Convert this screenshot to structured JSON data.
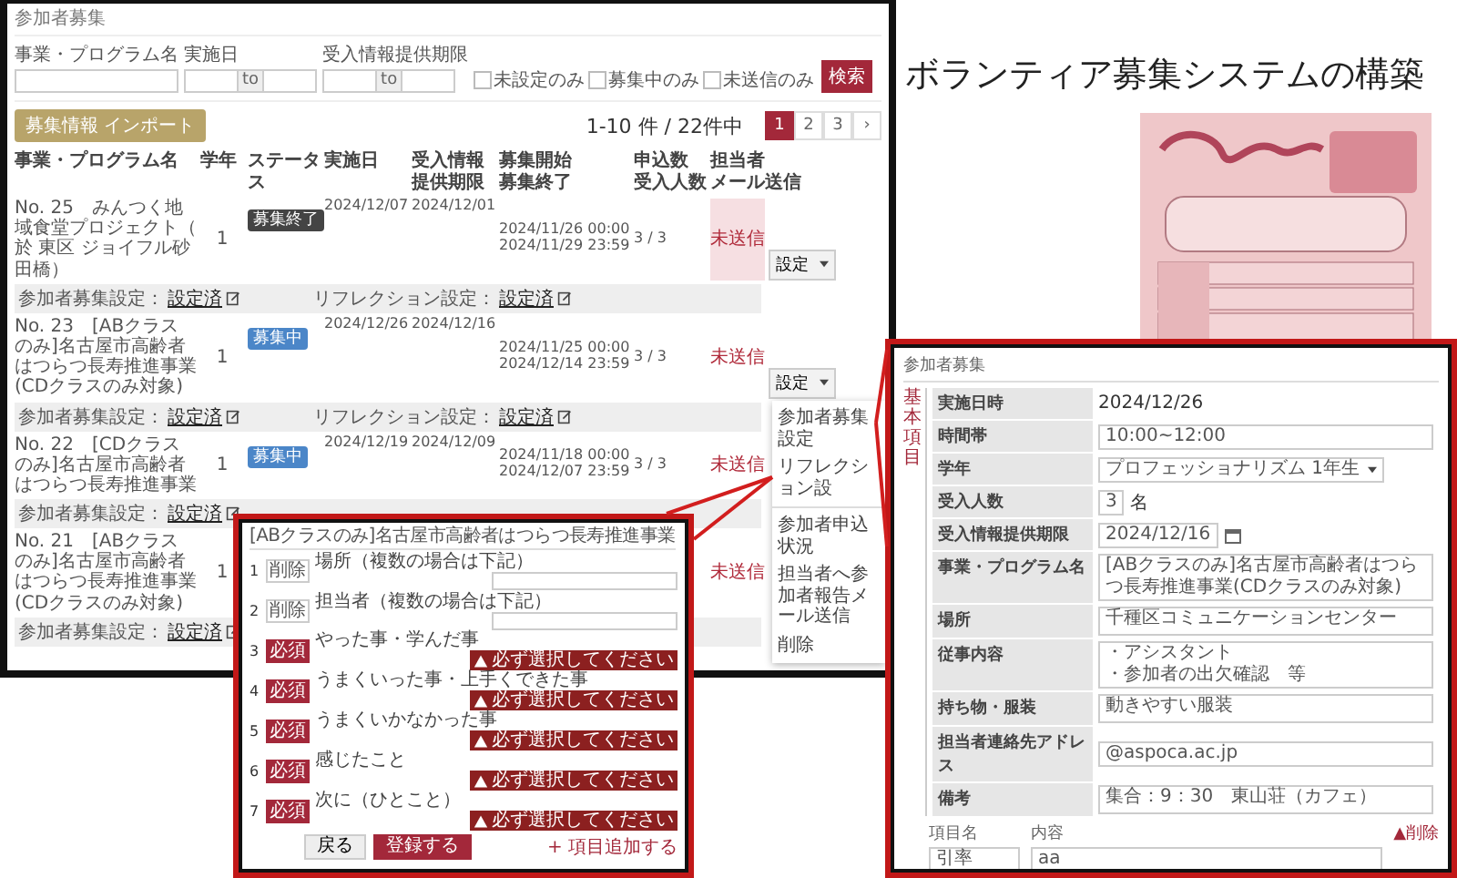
{
  "slide_title": "ボランティア募集システムの構築",
  "main": {
    "title": "参加者募集",
    "filters": [
      {
        "label": "事業・プログラム名",
        "kind": "text"
      },
      {
        "label": "実施日",
        "kind": "range",
        "separator": "to"
      },
      {
        "label": "受入情報提供期限",
        "kind": "range",
        "separator": "to"
      }
    ],
    "checkboxes": [
      {
        "label": "未設定のみ",
        "checked": false
      },
      {
        "label": "募集中のみ",
        "checked": false
      },
      {
        "label": "未送信のみ",
        "checked": false
      }
    ],
    "search_button": "検索",
    "import_button": "募集情報 インポート",
    "count": "1-10 件 / 22件中",
    "pages": [
      {
        "label": "1",
        "selected": true
      },
      {
        "label": "2",
        "selected": false
      },
      {
        "label": "3",
        "selected": false
      },
      {
        "label": "›",
        "selected": false
      }
    ],
    "columns": [
      [
        "事業・プログラム名"
      ],
      [
        "学年"
      ],
      [
        "ステータ",
        "ス"
      ],
      [
        "実施日"
      ],
      [
        "受入情報",
        "提供期限"
      ],
      [
        "募集開始",
        "募集終了"
      ],
      [
        "申込数",
        "受入人数"
      ],
      [
        "担当者",
        "メール送信"
      ]
    ],
    "rows": [
      {
        "name": "No. 25　みんつく地域食堂プロジェクト（於 東区 ジョイフル砂田橋）",
        "grade": "1",
        "status": {
          "label": "募集終了",
          "kind": "closed"
        },
        "date": "2024/12/07",
        "deadline": "2024/12/01",
        "period": [
          "2024/11/26 00:00",
          "2024/11/29 23:59"
        ],
        "count": "3 / 3",
        "mail": "未送信",
        "highlighted": true,
        "action": "設定",
        "settings": [
          {
            "label": "参加者募集設定：",
            "value": "設定済"
          },
          {
            "label": "リフレクション設定：",
            "value": "設定済"
          }
        ]
      },
      {
        "name": "No. 23　[ABクラスのみ]名古屋市高齢者はつらつ長寿推進事業(CDクラスのみ対象)",
        "grade": "1",
        "status": {
          "label": "募集中",
          "kind": "open"
        },
        "date": "2024/12/26",
        "deadline": "2024/12/16",
        "period": [
          "2024/11/25 00:00",
          "2024/12/14 23:59"
        ],
        "count": "3 / 3",
        "mail": "未送信",
        "highlighted": false,
        "action": "設定",
        "settings": [
          {
            "label": "参加者募集設定：",
            "value": "設定済"
          },
          {
            "label": "リフレクション設定：",
            "value": "設定済"
          }
        ]
      },
      {
        "name": "No. 22　[CDクラスのみ]名古屋市高齢者はつらつ長寿推進事業",
        "grade": "1",
        "status": {
          "label": "募集中",
          "kind": "open"
        },
        "date": "2024/12/19",
        "deadline": "2024/12/09",
        "period": [
          "2024/11/18 00:00",
          "2024/12/07 23:59"
        ],
        "count": "3 / 3",
        "mail": "未送信",
        "highlighted": false,
        "settings": [
          {
            "label": "参加者募集設定：",
            "value": "設定済"
          }
        ]
      },
      {
        "name": "No. 21　[ABクラスのみ]名古屋市高齢者はつらつ長寿推進事業(CDクラスのみ対象)",
        "grade": "1",
        "mail": "未送信",
        "highlighted": false,
        "settings": [
          {
            "label": "参加者募集設定：",
            "value": "設定済"
          }
        ]
      }
    ],
    "menu": [
      {
        "label": "参加者募集設定",
        "kind": "item"
      },
      {
        "label": "リフレクション設",
        "kind": "item"
      },
      {
        "kind": "divider"
      },
      {
        "label": "参加者申込状況",
        "kind": "item"
      },
      {
        "label": "担当者へ参加者報告メール送信",
        "kind": "item"
      },
      {
        "label": "削除",
        "kind": "item"
      }
    ]
  },
  "reflection_form": {
    "header": "[ABクラスのみ]名古屋市高齢者はつらつ長寿推進事業",
    "items": [
      {
        "number": "1",
        "required": false,
        "badge": "削除",
        "question": "場所（複数の場合は下記）"
      },
      {
        "number": "2",
        "required": false,
        "badge": "削除",
        "question": "担当者（複数の場合は下記）"
      },
      {
        "number": "3",
        "required": true,
        "badge": "必須",
        "question": "やった事・学んだ事",
        "warning": "必ず選択してください"
      },
      {
        "number": "4",
        "required": true,
        "badge": "必須",
        "question": "うまくいった事・上手くできた事",
        "warning": "必ず選択してください"
      },
      {
        "number": "5",
        "required": true,
        "badge": "必須",
        "question": "うまくいかなかった事",
        "warning": "必ず選択してください"
      },
      {
        "number": "6",
        "required": true,
        "badge": "必須",
        "question": "感じたこと",
        "warning": "必ず選択してください"
      },
      {
        "number": "7",
        "required": true,
        "badge": "必須",
        "question": "次に（ひとこと）",
        "warning": "必ず選択してください"
      }
    ],
    "add_link": "+ 項目追加する",
    "buttons": [
      "戻る",
      "登録する"
    ]
  },
  "recruit_form": {
    "title": "参加者募集",
    "side_tab": "基本項目",
    "fields": [
      {
        "label": "実施日時",
        "kind": "text",
        "value": "2024/12/26"
      },
      {
        "label": "時間帯",
        "kind": "input",
        "value": "10:00~12:00"
      },
      {
        "label": "学年",
        "kind": "select",
        "value": "プロフェッショナリズム 1年生"
      },
      {
        "label": "受入人数",
        "kind": "number",
        "value": "3",
        "unit": "名"
      },
      {
        "label": "受入情報提供期限",
        "kind": "date",
        "value": "2024/12/16"
      },
      {
        "label": "事業・プログラム名",
        "kind": "input",
        "value": "[ABクラスのみ]名古屋市高齢者はつらつ長寿推進事業(CDクラスのみ対象)"
      },
      {
        "label": "場所",
        "kind": "textarea",
        "lines": [
          "千種区コミュニケーションセンター"
        ]
      },
      {
        "label": "従事内容",
        "kind": "textarea",
        "lines": [
          "・アシスタント",
          "・参加者の出欠確認　等"
        ]
      },
      {
        "label": "持ち物・服装",
        "kind": "textarea",
        "lines": [
          "動きやすい服装"
        ]
      },
      {
        "label": "担当者連絡先アドレス",
        "kind": "input",
        "value": "@aspoca.ac.jp"
      },
      {
        "label": "備考",
        "kind": "textarea",
        "lines": [
          "集合：9：30　東山荘（カフェ）"
        ]
      }
    ],
    "extra": {
      "name_label": "項目名",
      "name_value": "引率",
      "content_label": "内容",
      "content_value": "aa",
      "delete": "▲削除"
    }
  }
}
